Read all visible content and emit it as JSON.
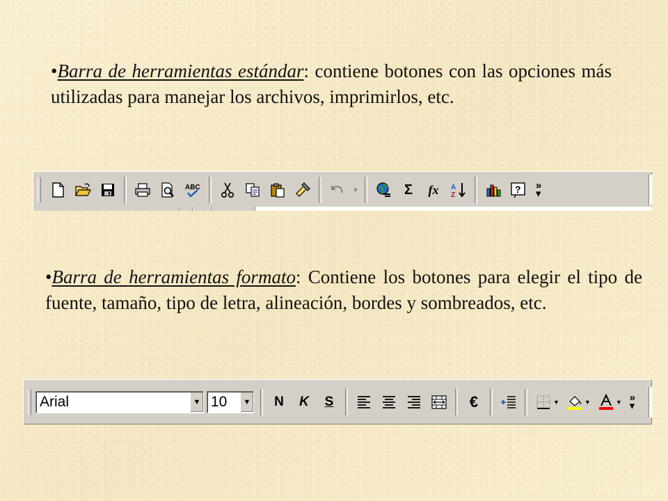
{
  "paragraph1": {
    "bullet": "•",
    "term": "Barra de herramientas estándar",
    "text": ": contiene botones con las opciones más utilizadas para manejar los archivos, imprimirlos, etc."
  },
  "paragraph2": {
    "bullet": "•",
    "term": "Barra de herramientas formato",
    "text": ": Contiene los botones para elegir el tipo de fuente, tamaño, tipo de letra, alineación, bordes y sombreados, etc."
  },
  "standard_toolbar": {
    "icons": [
      "new-icon",
      "open-icon",
      "save-icon",
      "print-icon",
      "print-preview-icon",
      "spelling-icon",
      "cut-icon",
      "copy-icon",
      "paste-icon",
      "format-painter-icon",
      "undo-icon",
      "hyperlink-icon",
      "autosum-icon",
      "function-icon",
      "sort-icon",
      "chart-wizard-icon",
      "help-icon",
      "more-buttons-icon"
    ],
    "autosum_glyph": "Σ",
    "function_glyph": "fx"
  },
  "format_toolbar": {
    "font_value": "Arial",
    "size_value": "10",
    "bold_label": "N",
    "italic_label": "K",
    "underline_label": "S",
    "euro_label": "€",
    "colors": {
      "fill": "#ffff00",
      "font": "#ff0000",
      "toolbar": "#d4d0c8"
    }
  }
}
